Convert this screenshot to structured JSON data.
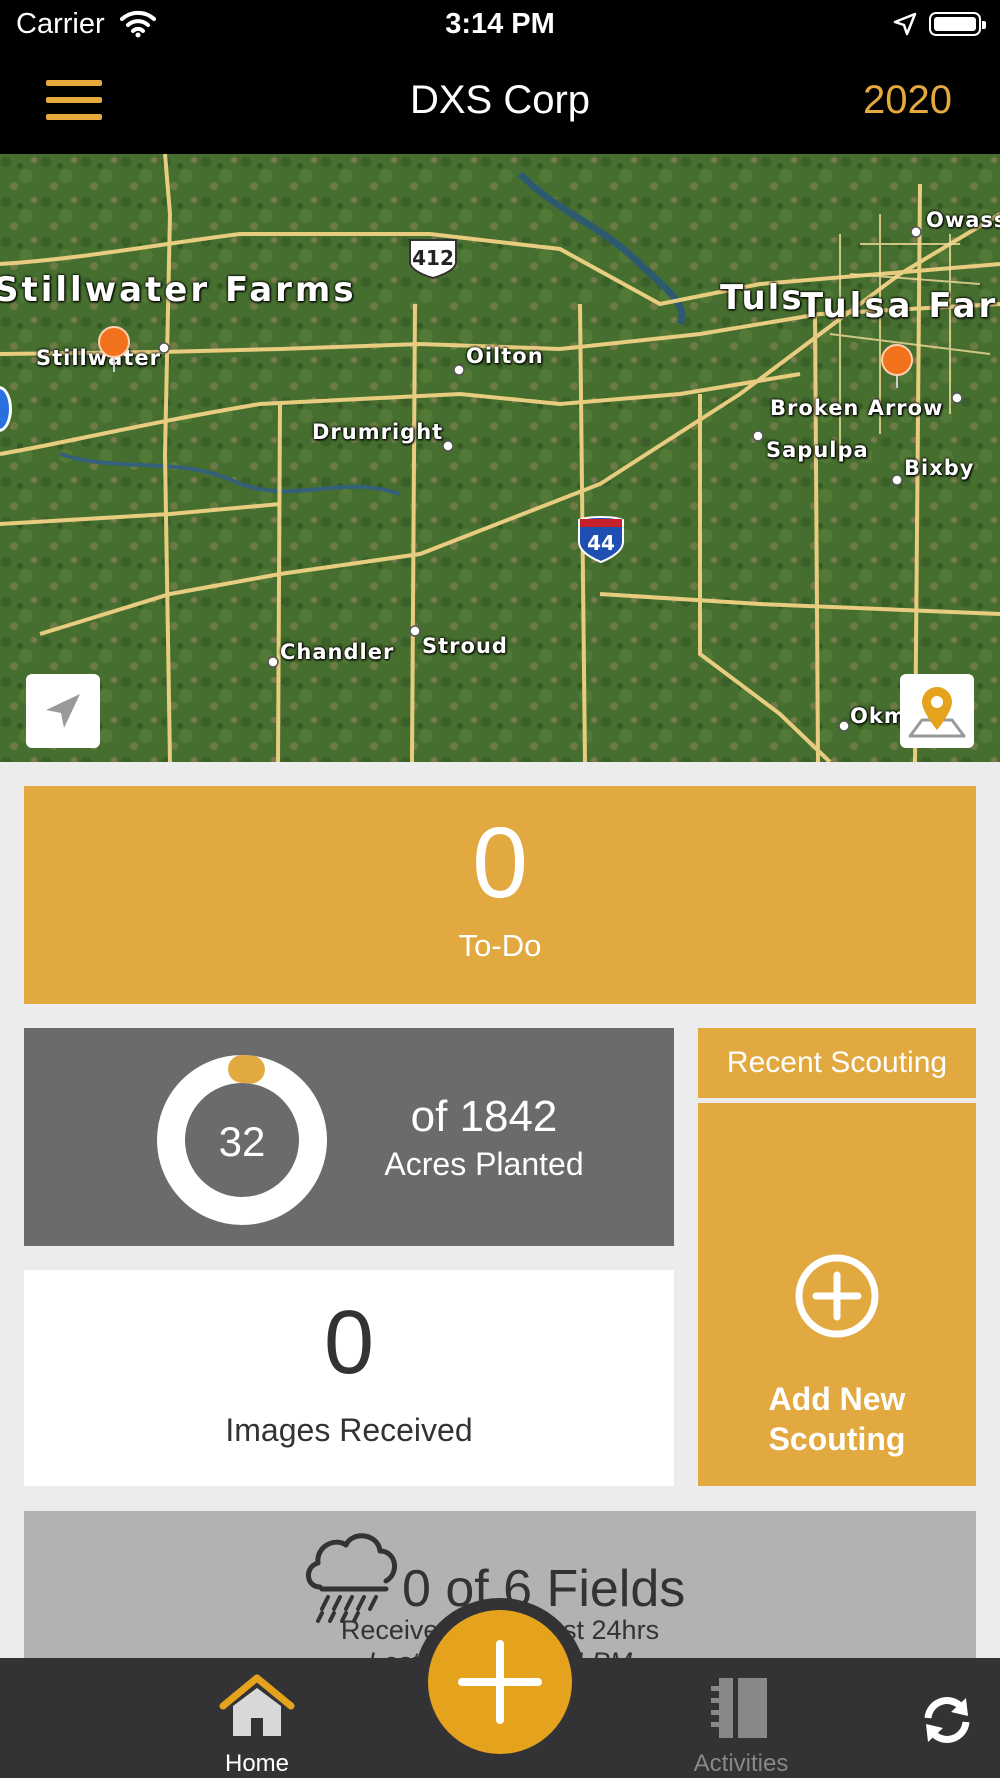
{
  "status_bar": {
    "carrier": "Carrier",
    "time": "3:14 PM"
  },
  "header": {
    "title": "DXS Corp",
    "year": "2020"
  },
  "map": {
    "farms": [
      "Stillwater Farms",
      "Tulsa Far"
    ],
    "places": {
      "stillwater": "Stillwater",
      "oilton": "Oilton",
      "drumright": "Drumright",
      "tulsa": "Tuls",
      "owasso": "Owass",
      "broken_arrow": "Broken Arrow",
      "sapulpa": "Sapulpa",
      "bixby": "Bixby",
      "chandler": "Chandler",
      "stroud": "Stroud",
      "okmulgee": "Okm"
    },
    "highways": {
      "us": "412",
      "interstate": "44"
    }
  },
  "todo": {
    "count": "0",
    "label": "To-Do"
  },
  "acres": {
    "planted": "32",
    "total_text": "of 1842",
    "unit": "Acres Planted",
    "progress_fraction": 0.0174
  },
  "images": {
    "count": "0",
    "label": "Images Received"
  },
  "scouting": {
    "header": "Recent Scouting",
    "add_label_line1": "Add New",
    "add_label_line2": "Scouting"
  },
  "weather": {
    "fields_text": "0 of 6 Fields",
    "subtitle": "Received rain in last 24hrs",
    "subtitle2": "Last updated 3:14 PM"
  },
  "tabs": {
    "home": "Home",
    "activities": "Activities"
  },
  "colors": {
    "accent": "#e1a940",
    "fab": "#e5a31d",
    "pin": "#f2711c",
    "dark": "#333335"
  }
}
